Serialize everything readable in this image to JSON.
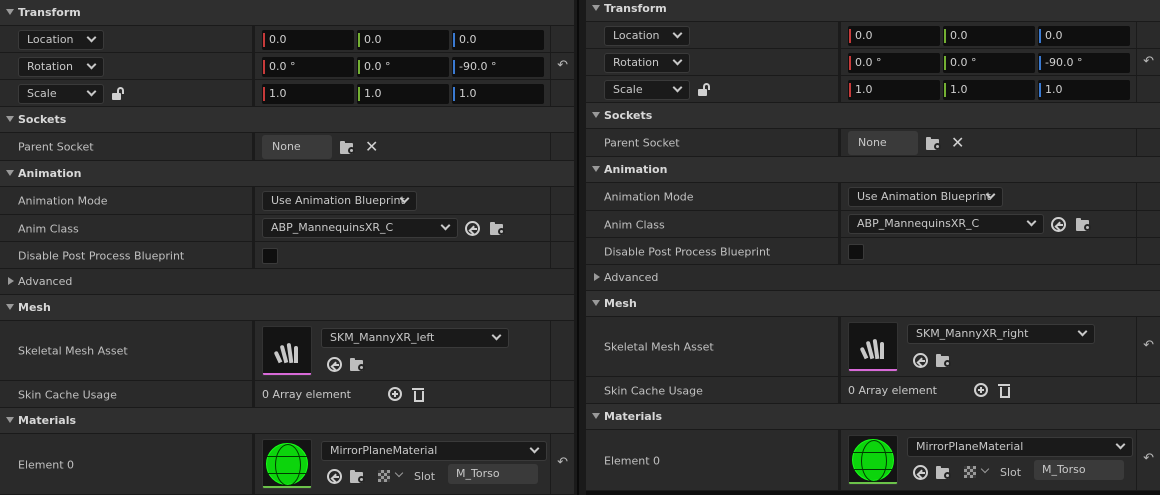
{
  "panels": [
    {
      "id": "left",
      "transform": {
        "title": "Transform",
        "location_label": "Location",
        "location": [
          "0.0",
          "0.0",
          "0.0"
        ],
        "rotation_label": "Rotation",
        "rotation": [
          "0.0 °",
          "0.0 °",
          "-90.0 °"
        ],
        "scale_label": "Scale",
        "scale": [
          "1.0",
          "1.0",
          "1.0"
        ]
      },
      "sockets": {
        "title": "Sockets",
        "parent_socket_label": "Parent Socket",
        "parent_socket_value": "None"
      },
      "animation": {
        "title": "Animation",
        "mode_label": "Animation Mode",
        "mode_value": "Use Animation Blueprint",
        "anim_class_label": "Anim Class",
        "anim_class_value": "ABP_MannequinsXR_C",
        "disable_pp_label": "Disable Post Process Blueprint",
        "advanced_label": "Advanced"
      },
      "mesh": {
        "title": "Mesh",
        "asset_label": "Skeletal Mesh Asset",
        "asset_value": "SKM_MannyXR_left",
        "skin_cache_label": "Skin Cache Usage",
        "skin_cache_value": "0 Array element"
      },
      "materials": {
        "title": "Materials",
        "element_label": "Element 0",
        "material_value": "MirrorPlaneMaterial",
        "slot_label": "Slot",
        "slot_value": "M_Torso"
      }
    },
    {
      "id": "right",
      "transform": {
        "title": "Transform",
        "location_label": "Location",
        "location": [
          "0.0",
          "0.0",
          "0.0"
        ],
        "rotation_label": "Rotation",
        "rotation": [
          "0.0 °",
          "0.0 °",
          "-90.0 °"
        ],
        "scale_label": "Scale",
        "scale": [
          "1.0",
          "1.0",
          "1.0"
        ]
      },
      "sockets": {
        "title": "Sockets",
        "parent_socket_label": "Parent Socket",
        "parent_socket_value": "None"
      },
      "animation": {
        "title": "Animation",
        "mode_label": "Animation Mode",
        "mode_value": "Use Animation Blueprint",
        "anim_class_label": "Anim Class",
        "anim_class_value": "ABP_MannequinsXR_C",
        "disable_pp_label": "Disable Post Process Blueprint",
        "advanced_label": "Advanced"
      },
      "mesh": {
        "title": "Mesh",
        "asset_label": "Skeletal Mesh Asset",
        "asset_value": "SKM_MannyXR_right",
        "skin_cache_label": "Skin Cache Usage",
        "skin_cache_value": "0 Array element"
      },
      "materials": {
        "title": "Materials",
        "element_label": "Element 0",
        "material_value": "MirrorPlaneMaterial",
        "slot_label": "Slot",
        "slot_value": "M_Torso"
      }
    }
  ],
  "icons": {
    "reset": "reset-arrow-icon",
    "browse": "browse-folder-icon",
    "clear": "clear-x-icon",
    "use_selected": "use-selected-arrow-icon",
    "lock": "lock-icon",
    "add": "plus-circle-icon",
    "delete": "trash-icon"
  },
  "colors": {
    "x_axis": "#c73a3a",
    "y_axis": "#74b033",
    "z_axis": "#3a7ad2",
    "mesh_thumb": "#d86ad8",
    "material_sphere": "#0cd40c"
  }
}
